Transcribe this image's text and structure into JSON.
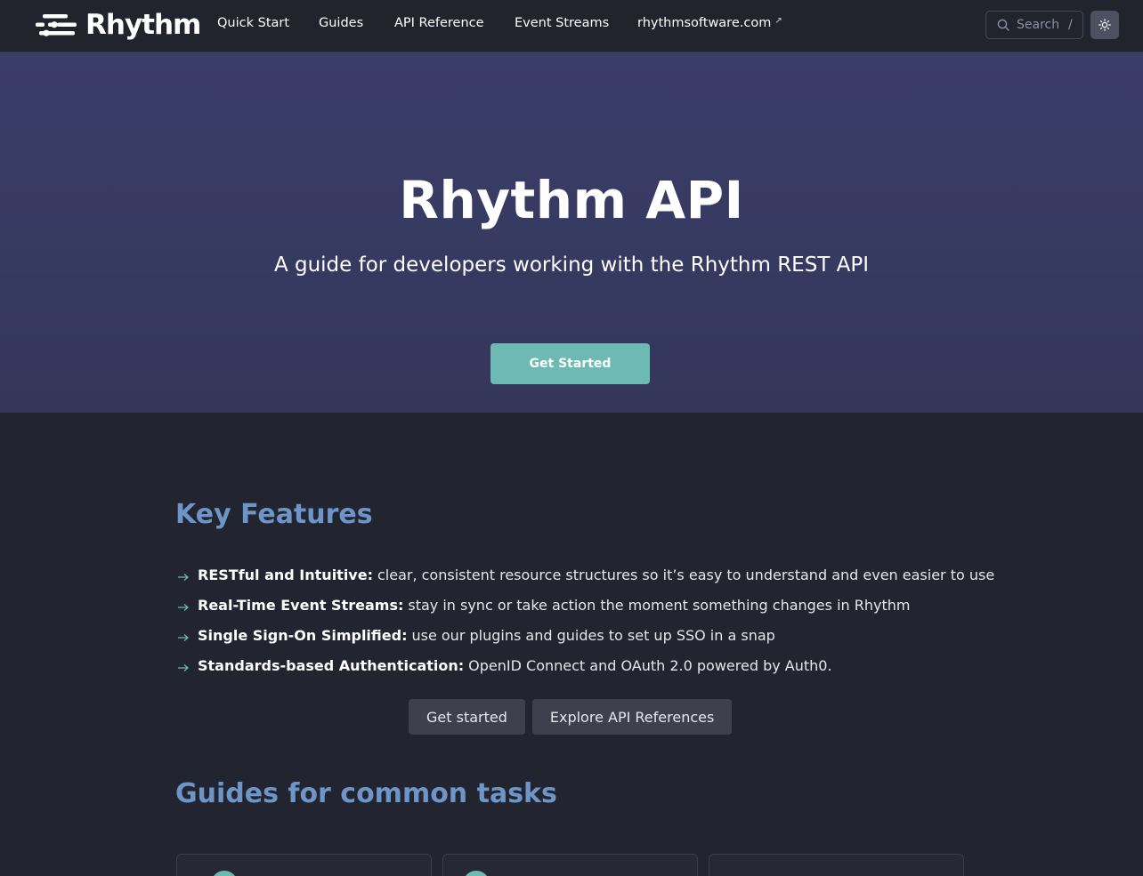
{
  "nav": {
    "brand": "Rhythm",
    "links": [
      "Quick Start",
      "Guides",
      "API Reference",
      "Event Streams",
      "rhythmsoftware.com"
    ],
    "search_placeholder": "Search",
    "search_shortcut": "/"
  },
  "hero": {
    "title": "Rhythm API",
    "subtitle": "A guide for developers working with the Rhythm REST API",
    "button": "Get Started"
  },
  "features": {
    "title": "Key Features",
    "items": [
      {
        "label": "RESTful and Intuitive:",
        "text": "clear, consistent resource structures so it’s easy to understand and even easier to use"
      },
      {
        "label": "Real-Time Event Streams:",
        "text": "stay in sync or take action the moment something changes in Rhythm"
      },
      {
        "label": "Single Sign-On Simplified:",
        "text": "use our plugins and guides to set up SSO in a snap"
      },
      {
        "label": "Standards-based Authentication:",
        "text": "OpenID Connect and OAuth 2.0 powered by Auth0."
      }
    ],
    "buttons": [
      "Get started",
      "Explore API References"
    ]
  },
  "guides": {
    "title": "Guides for common tasks"
  },
  "colors": {
    "accent": "#6dbab4",
    "heading": "#6e95c7",
    "hero_bg": "#383b63",
    "page_bg": "#22252f"
  }
}
